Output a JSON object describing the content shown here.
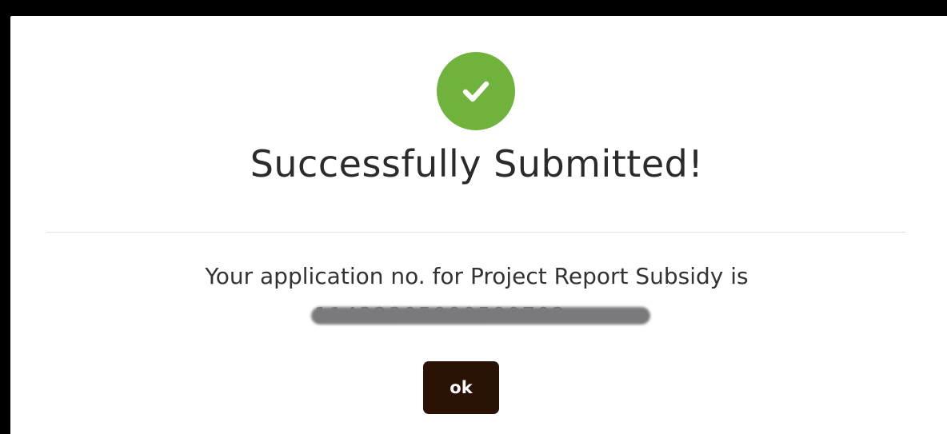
{
  "dialog": {
    "icon": "check-circle-icon",
    "icon_color": "#6fb33d",
    "title": "Successfully Submitted!",
    "message": "Your application no. for Project Report Subsidy is",
    "application_number": "11432305000500702",
    "application_number_redacted": true,
    "ok_label": "ok",
    "ok_button_color": "#2a1205"
  }
}
